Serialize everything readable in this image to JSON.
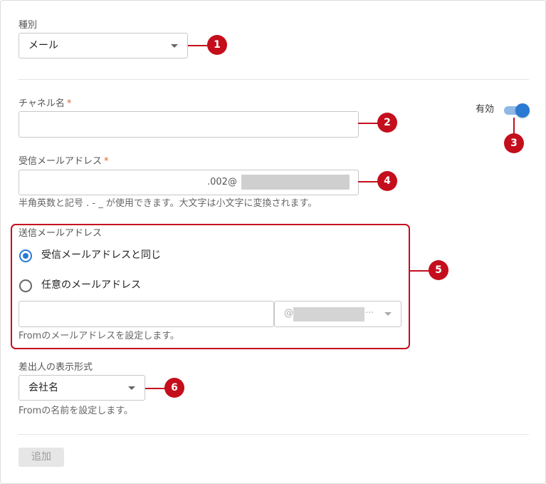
{
  "type_field": {
    "label": "種別",
    "value": "メール"
  },
  "channel_name": {
    "label": "チャネル名",
    "required_mark": "*",
    "value": ""
  },
  "enabled_toggle": {
    "label": "有効",
    "checked": true
  },
  "receive_address": {
    "label": "受信メールアドレス",
    "required_mark": "*",
    "value_visible": ".002@",
    "hint": "半角英数と記号 . - _ が使用できます。大文字は小文字に変換されます。"
  },
  "send_address": {
    "label": "送信メールアドレス",
    "option_same": "受信メールアドレスと同じ",
    "option_custom": "任意のメールアドレス",
    "selected": "same",
    "local_part_value": "",
    "domain_prefix": "@",
    "domain_suffix": "···",
    "hint": "Fromのメールアドレスを設定します。"
  },
  "sender_display": {
    "label": "差出人の表示形式",
    "value": "会社名",
    "hint": "Fromの名前を設定します。"
  },
  "add_button": {
    "label": "追加",
    "disabled": true
  },
  "callouts": [
    "1",
    "2",
    "3",
    "4",
    "5",
    "6"
  ],
  "colors": {
    "accent": "#2a7ad4",
    "callout": "#c40e1c",
    "required": "#e0662d"
  }
}
